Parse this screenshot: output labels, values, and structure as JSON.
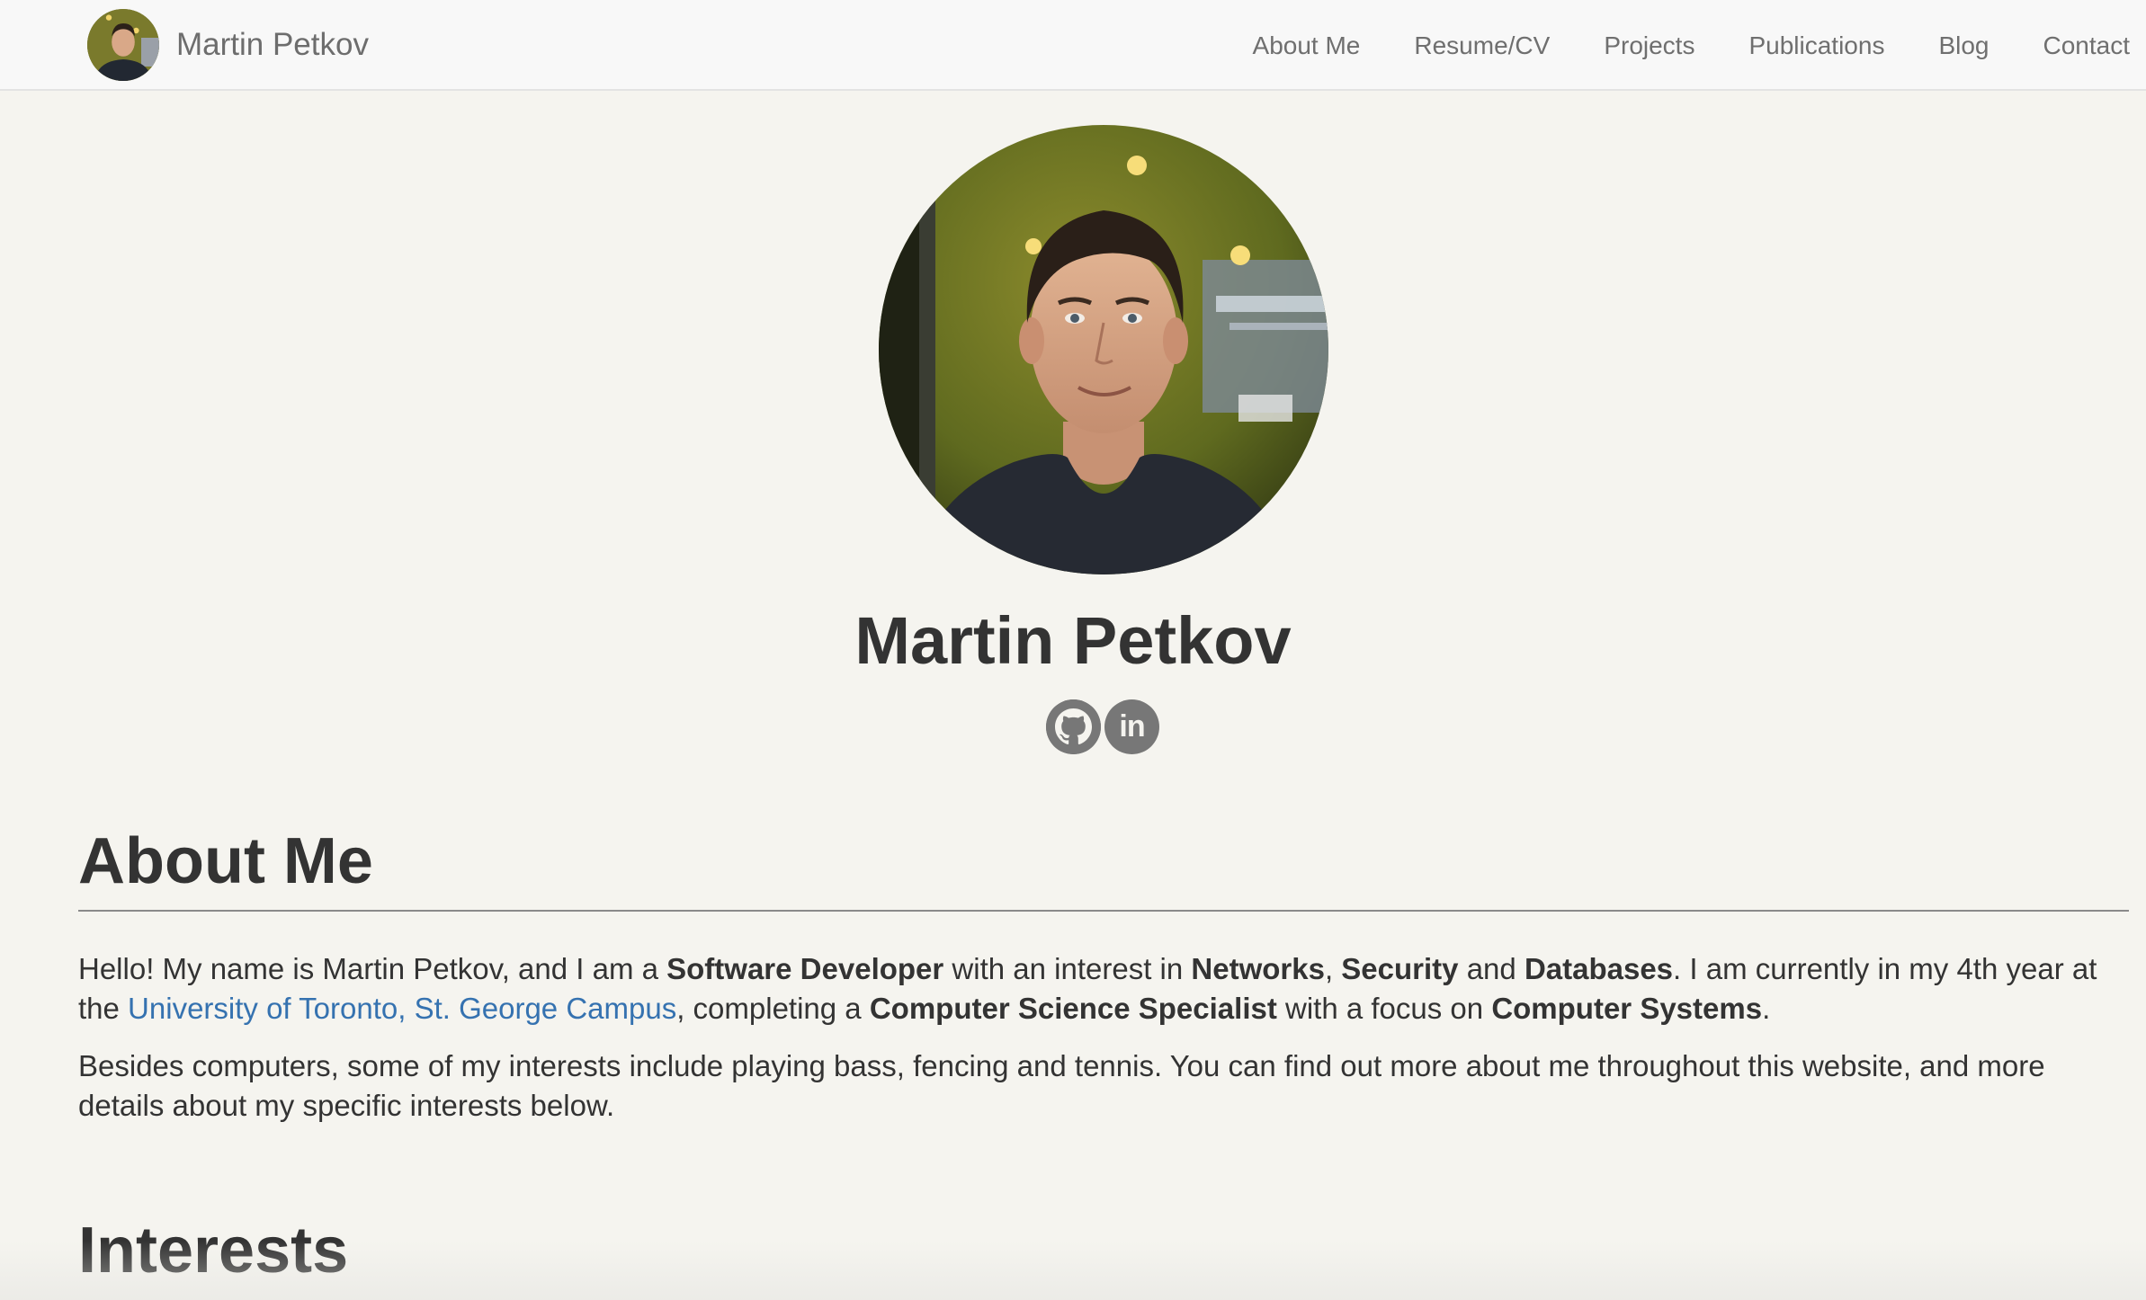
{
  "navbar": {
    "brand_name": "Martin Petkov",
    "links": [
      "About Me",
      "Resume/CV",
      "Projects",
      "Publications",
      "Blog",
      "Contact"
    ]
  },
  "hero": {
    "name": "Martin Petkov",
    "social": [
      {
        "icon": "github-icon"
      },
      {
        "icon": "linkedin-icon",
        "glyph": "in"
      }
    ]
  },
  "about": {
    "title": "About Me",
    "p1": {
      "t1": "Hello! My name is Martin Petkov, and I am a ",
      "b1": "Software Developer",
      "t2": " with an interest in ",
      "b2": "Networks",
      "t3": ", ",
      "b3": "Security",
      "t4": " and ",
      "b4": "Databases",
      "t5": ". I am currently in my 4th year at the ",
      "link": "University of Toronto, St. George Campus",
      "t6": ", completing a ",
      "b5": "Computer Science Specialist",
      "t7": " with a focus on ",
      "b6": "Computer Systems",
      "t8": "."
    },
    "p2": "Besides computers, some of my interests include playing bass, fencing and tennis. You can find out more about me throughout this website, and more details about my specific interests below."
  },
  "interests": {
    "title": "Interests"
  },
  "colors": {
    "page_bg": "#f5f4ef",
    "navbar_bg": "#f8f8f8",
    "text": "#333333",
    "nav_text": "#6f6f6f",
    "link": "#3572b0",
    "social_icon_bg": "#777777"
  }
}
